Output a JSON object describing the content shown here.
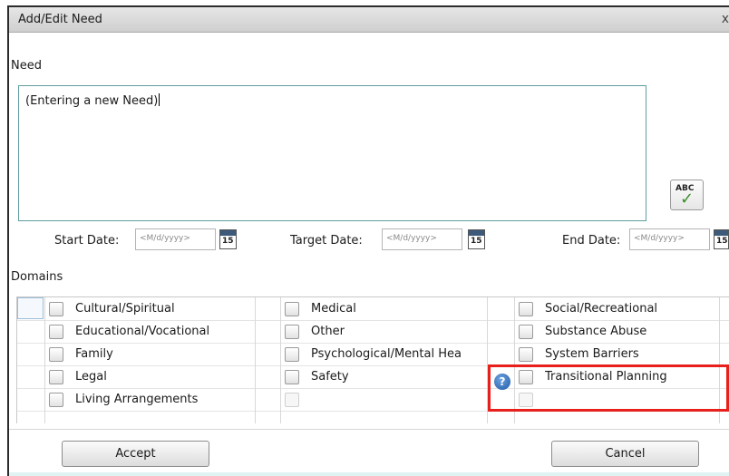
{
  "dialog": {
    "title": "Add/Edit Need",
    "close_glyph": "x"
  },
  "need": {
    "label": "Need",
    "value": "(Entering a new Need)"
  },
  "spellcheck": {
    "abc": "ABC",
    "icon": "spellcheck-icon"
  },
  "dates": {
    "start_label": "Start Date:",
    "target_label": "Target Date:",
    "end_label": "End Date:",
    "placeholder": "<M/d/yyyy>",
    "calendar_day": "15"
  },
  "domains": {
    "label": "Domains",
    "col1": [
      "Cultural/Spiritual",
      "Educational/Vocational",
      "Family",
      "Legal",
      "Living Arrangements"
    ],
    "col2": [
      "Medical",
      "Other",
      "Psychological/Mental Hea",
      "Safety"
    ],
    "col3": [
      "Social/Recreational",
      "Substance Abuse",
      "System Barriers",
      "Transitional Planning"
    ]
  },
  "buttons": {
    "accept": "Accept",
    "cancel": "Cancel"
  },
  "colors": {
    "highlight": "#e8201c",
    "help_icon": "#1f5aa6"
  }
}
